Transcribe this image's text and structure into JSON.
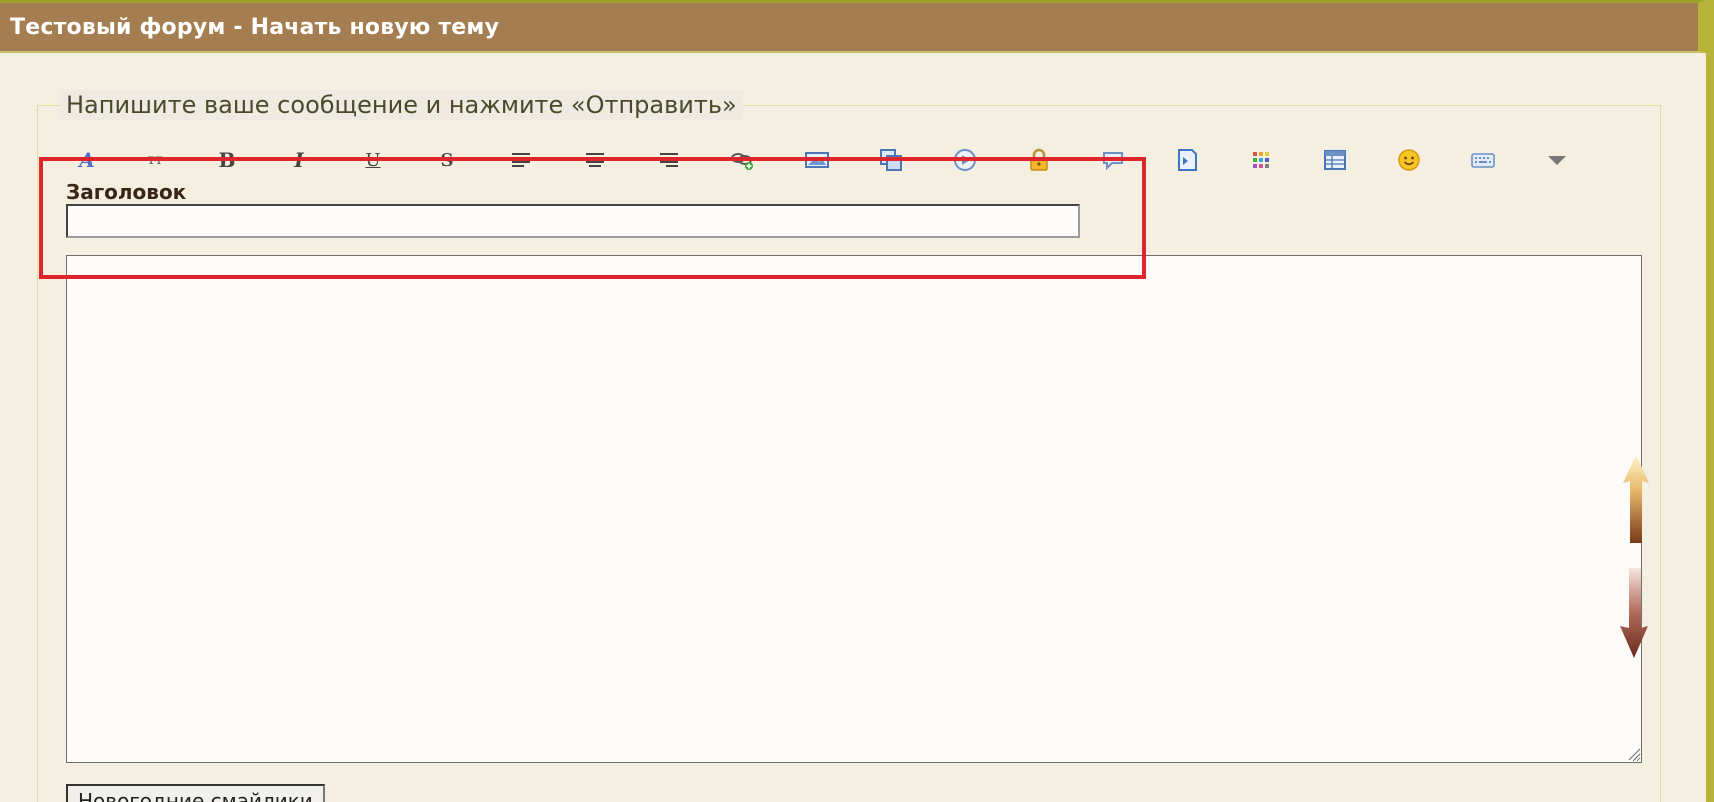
{
  "header": {
    "title": "Тестовый форум - Начать новую тему",
    "bar_color": "#a47d50"
  },
  "form": {
    "legend": "Напишите ваше сообщение и нажмите «Отправить»",
    "subject_label": "Заголовок",
    "subject_value": "",
    "message_value": "",
    "smileys_button": "Новогодние смайлики"
  },
  "toolbar": {
    "buttons": [
      {
        "name": "font-color-icon",
        "glyph": "A"
      },
      {
        "name": "font-size-icon",
        "glyph": "тт"
      },
      {
        "name": "bold-icon",
        "glyph": "B"
      },
      {
        "name": "italic-icon",
        "glyph": "I"
      },
      {
        "name": "underline-icon",
        "glyph": "U"
      },
      {
        "name": "strikethrough-icon",
        "glyph": "S"
      },
      {
        "name": "align-left-icon",
        "glyph": ""
      },
      {
        "name": "align-center-icon",
        "glyph": ""
      },
      {
        "name": "align-right-icon",
        "glyph": ""
      },
      {
        "name": "link-icon",
        "glyph": ""
      },
      {
        "name": "image-icon",
        "glyph": ""
      },
      {
        "name": "copy-icon",
        "glyph": ""
      },
      {
        "name": "video-icon",
        "glyph": ""
      },
      {
        "name": "hide-lock-icon",
        "glyph": ""
      },
      {
        "name": "quote-icon",
        "glyph": ""
      },
      {
        "name": "code-icon",
        "glyph": ""
      },
      {
        "name": "color-palette-icon",
        "glyph": ""
      },
      {
        "name": "table-icon",
        "glyph": ""
      },
      {
        "name": "smiley-icon",
        "glyph": ""
      },
      {
        "name": "keyboard-icon",
        "glyph": ""
      },
      {
        "name": "more-dropdown-icon",
        "glyph": ""
      }
    ]
  },
  "colors": {
    "page_background": "#f4efe0",
    "highlight_border": "#e0242c",
    "accent_right_edge": "#b8b43a"
  }
}
